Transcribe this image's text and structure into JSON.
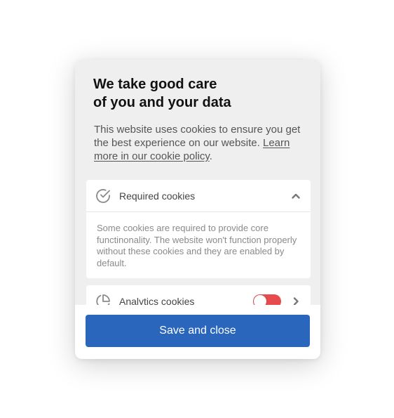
{
  "dialog": {
    "title_line1": "We take good care",
    "title_line2": "of you and your data",
    "description": "This website uses cookies to ensure you get the best experience on our website.",
    "policy_link": "Learn more in our cookie policy",
    "policy_suffix": "."
  },
  "categories": [
    {
      "label": "Required cookies",
      "icon": "check-circle-icon",
      "expanded": true,
      "description": "Some cookies are required to provide core functinonality. The website won't function properly without these cookies and they are enabled by default."
    },
    {
      "label": "Analytics cookies",
      "icon": "pie-chart-icon",
      "expanded": false,
      "enabled": false
    }
  ],
  "footer": {
    "save_label": "Save and close"
  },
  "colors": {
    "primary": "#2a66bb",
    "toggle_off": "#e74c4c",
    "panel_bg": "#efefef"
  }
}
